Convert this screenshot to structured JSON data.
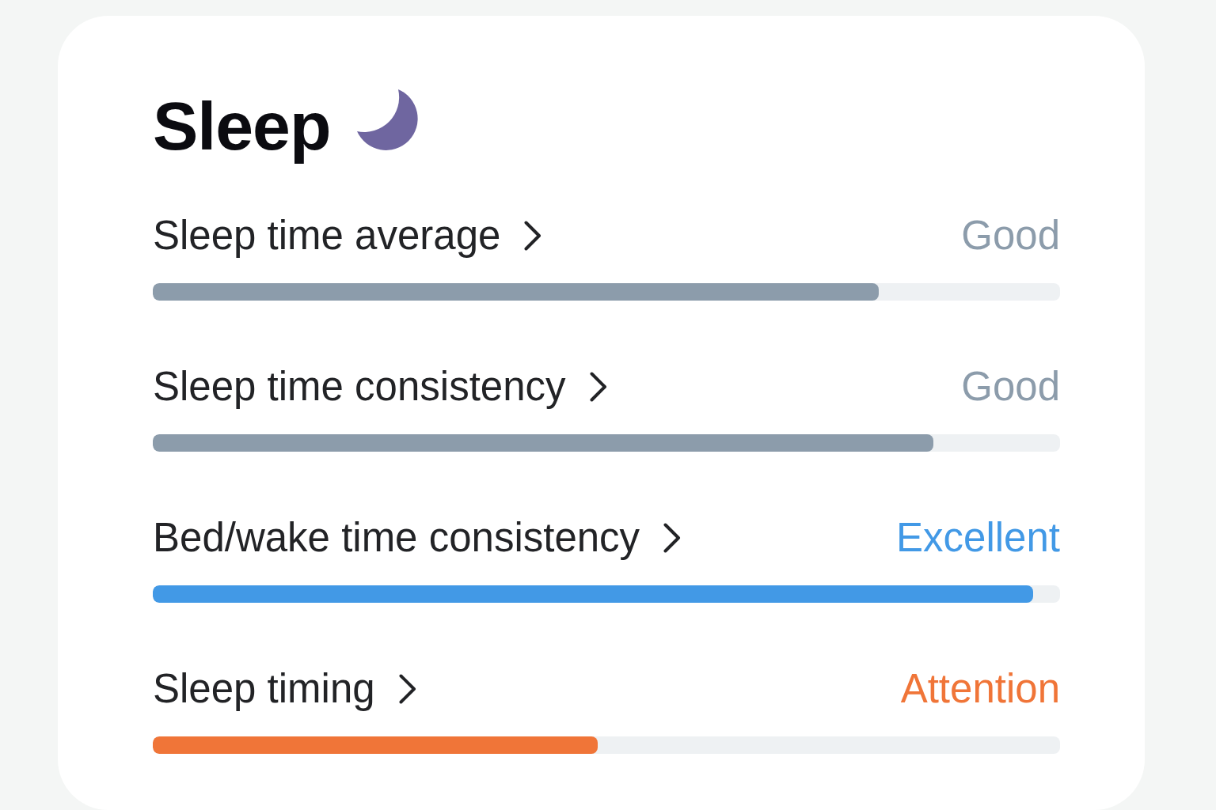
{
  "card": {
    "title": "Sleep"
  },
  "metrics": [
    {
      "label": "Sleep time average",
      "status": "Good",
      "level": 0.8,
      "color": "#8c9cab"
    },
    {
      "label": "Sleep time consistency",
      "status": "Good",
      "level": 0.86,
      "color": "#8c9cab"
    },
    {
      "label": "Bed/wake time consistency",
      "status": "Excellent",
      "level": 0.97,
      "color": "#4299e6"
    },
    {
      "label": "Sleep timing",
      "status": "Attention",
      "level": 0.49,
      "color": "#f07538"
    }
  ]
}
